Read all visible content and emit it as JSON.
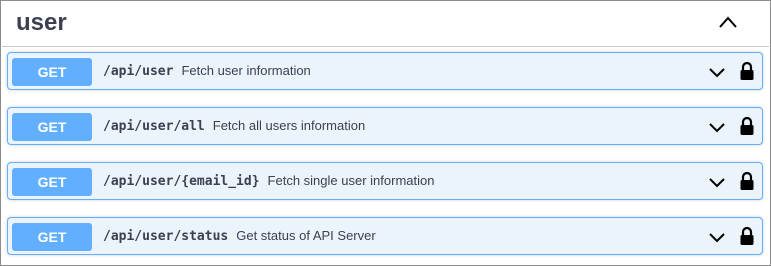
{
  "tag": {
    "name": "user",
    "collapse_icon": "chevron-up-icon"
  },
  "colors": {
    "get_method": "#61affe",
    "get_row_bg": "#ebf3fb",
    "text": "#3b4151"
  },
  "operations": [
    {
      "method": "GET",
      "path": "/api/user",
      "summary": "Fetch user information",
      "expand_icon": "chevron-down-icon",
      "auth_icon": "lock-icon"
    },
    {
      "method": "GET",
      "path": "/api/user/all",
      "summary": "Fetch all users information",
      "expand_icon": "chevron-down-icon",
      "auth_icon": "lock-icon"
    },
    {
      "method": "GET",
      "path": "/api/user/{email_id}",
      "summary": "Fetch single user information",
      "expand_icon": "chevron-down-icon",
      "auth_icon": "lock-icon"
    },
    {
      "method": "GET",
      "path": "/api/user/status",
      "summary": "Get status of API Server",
      "expand_icon": "chevron-down-icon",
      "auth_icon": "lock-icon"
    }
  ]
}
